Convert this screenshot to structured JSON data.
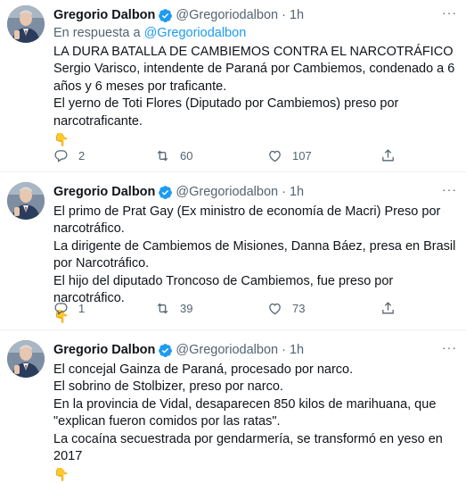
{
  "tweets": [
    {
      "author_name": "Gregorio Dalbon",
      "author_handle": "@Gregoriodalbon",
      "separator": "·",
      "time": "1h",
      "more": "···",
      "reply_prefix": "En respuesta a",
      "reply_mention": "@Gregoriodalbon",
      "lines": [
        "LA DURA BATALLA DE CAMBIEMOS CONTRA EL NARCOTRÁFICO",
        "Sergio Varisco, intendente de Paraná por Cambiemos, condenado a 6 años y 6 meses por traficante.",
        "El yerno de Toti Flores (Diputado por Cambiemos) preso por narcotraficante."
      ],
      "emoji": "👇",
      "replies": "2",
      "retweets": "60",
      "likes": "107"
    },
    {
      "author_name": "Gregorio Dalbon",
      "author_handle": "@Gregoriodalbon",
      "separator": "·",
      "time": "1h",
      "more": "···",
      "lines": [
        "El primo de Prat Gay (Ex ministro de economía de Macri) Preso por narcotráfico.",
        "La dirigente de Cambiemos de Misiones, Danna Báez, presa en Brasil por Narcotráfico.",
        "El hijo del diputado Troncoso de Cambiemos, fue preso por narcotráfico."
      ],
      "emoji": "👇",
      "replies": "1",
      "retweets": "39",
      "likes": "73"
    },
    {
      "author_name": "Gregorio Dalbon",
      "author_handle": "@Gregoriodalbon",
      "separator": "·",
      "time": "1h",
      "more": "···",
      "lines": [
        "El concejal Gainza de Paraná, procesado por narco.",
        "El sobrino de Stolbizer, preso por narco.",
        "En la provincia de Vidal, desaparecen 850 kilos de marihuana, que \"explican fueron comidos por las ratas\".",
        "La cocaína secuestrada por gendarmería, se transformó en yeso en 2017"
      ],
      "emoji": "👇"
    }
  ],
  "colors": {
    "text": "#0f1419",
    "secondary": "#536471",
    "accent": "#1d9bf0",
    "divider": "#eff3f4"
  },
  "icons": [
    "verified-badge-icon",
    "reply-icon",
    "retweet-icon",
    "like-icon",
    "share-icon",
    "more-icon",
    "point-down-emoji"
  ]
}
